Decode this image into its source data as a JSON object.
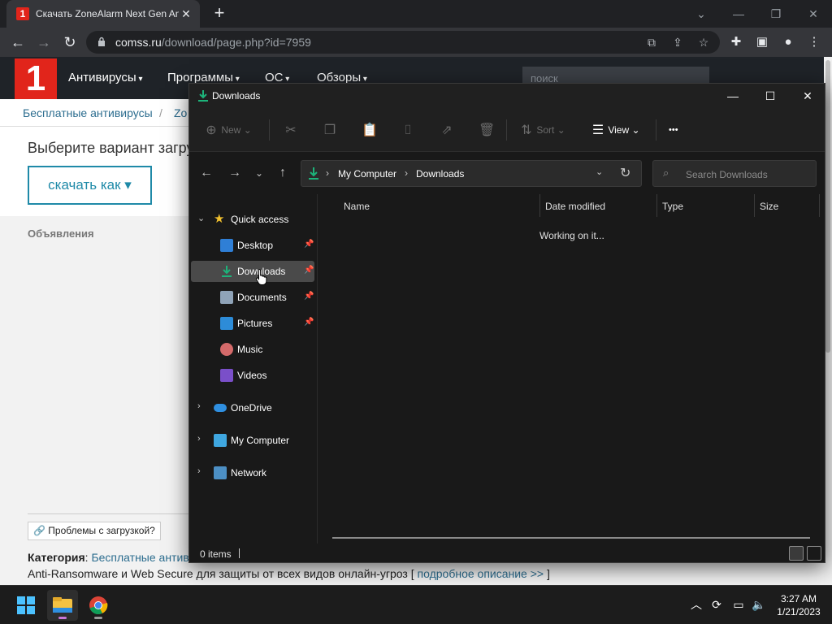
{
  "browser": {
    "tab_title": "Скачать ZoneAlarm Next Gen Antivirus",
    "tab_favicon_text": "1",
    "url_host": "comss.ru",
    "url_path": "/download/page.php?id=7959",
    "icons": [
      "back-icon",
      "forward-icon",
      "reload-icon",
      "lock-icon",
      "translate-icon",
      "share-icon",
      "star-icon",
      "extensions-icon",
      "sidepanel-icon",
      "profile-icon",
      "menu-icon"
    ]
  },
  "site": {
    "logo_text": "1",
    "nav": [
      "Антивирусы",
      "Программы",
      "ОС",
      "Обзоры"
    ],
    "search_placeholder": "поиск",
    "breadcrumbs": [
      "Бесплатные антивирусы",
      "/",
      "Zo"
    ],
    "choose_text": "Выберите вариант загру",
    "download_as_label": "скачать как",
    "ads_label": "Объявления",
    "problem_label": "Проблемы с загрузкой?",
    "category_label": "Категория",
    "category_colon": ":",
    "category_value": "Бесплатные антив",
    "desc_text": "Anti-Ransomware и Web Secure для защиты от всех видов онлайн-угроз [",
    "desc_link": "подробное описание >>",
    "desc_close": "]"
  },
  "explorer": {
    "title": "Downloads",
    "commands": {
      "new": "New",
      "sort": "Sort",
      "view": "View",
      "more": "•••"
    },
    "address": [
      "My Computer",
      "Downloads"
    ],
    "search_placeholder": "Search Downloads",
    "sidebar": {
      "quick_access": "Quick access",
      "items": [
        {
          "label": "Desktop",
          "icon": "desktop-icon",
          "pinned": true
        },
        {
          "label": "Downloads",
          "icon": "downloads-icon",
          "pinned": true,
          "selected": true
        },
        {
          "label": "Documents",
          "icon": "documents-icon",
          "pinned": true
        },
        {
          "label": "Pictures",
          "icon": "pictures-icon",
          "pinned": true
        },
        {
          "label": "Music",
          "icon": "music-icon",
          "pinned": false
        },
        {
          "label": "Videos",
          "icon": "videos-icon",
          "pinned": false
        }
      ],
      "roots": [
        "OneDrive",
        "My Computer",
        "Network"
      ]
    },
    "columns": [
      "Name",
      "Date modified",
      "Type",
      "Size"
    ],
    "status_message": "Working on it...",
    "item_count": "0 items"
  },
  "taskbar": {
    "time": "3:27 AM",
    "date": "1/21/2023",
    "apps": [
      "start-icon",
      "file-explorer-icon",
      "chrome-icon"
    ],
    "tray": [
      "chevron-up-icon",
      "sync-icon",
      "display-icon",
      "volume-icon"
    ]
  },
  "colors": {
    "accent_green": "#1db37a",
    "site_red": "#e1251b",
    "link_blue": "#2c6d8f"
  }
}
